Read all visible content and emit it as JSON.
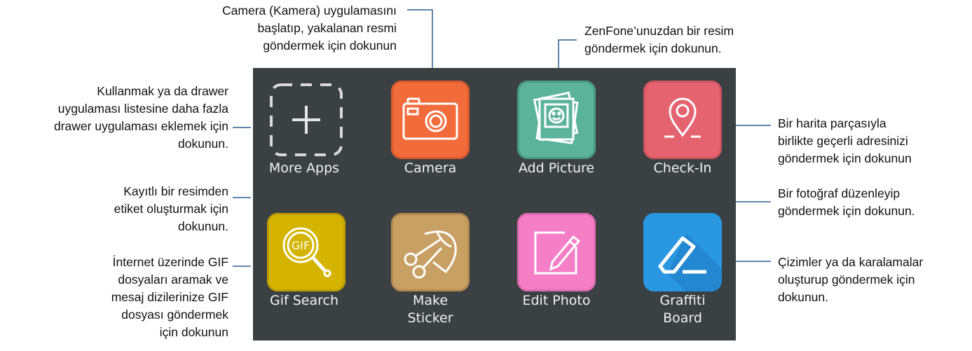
{
  "apps": [
    {
      "id": "more-apps",
      "label_lines": [
        "More Apps"
      ],
      "icon": "plus-icon"
    },
    {
      "id": "camera",
      "label_lines": [
        "Camera"
      ],
      "icon": "camera-icon",
      "color": "#f26b3a"
    },
    {
      "id": "add-picture",
      "label_lines": [
        "Add Picture"
      ],
      "icon": "photo-stack-icon",
      "color": "#5bb39a"
    },
    {
      "id": "check-in",
      "label_lines": [
        "Check-In"
      ],
      "icon": "map-pin-icon",
      "color": "#e4636f"
    },
    {
      "id": "gif-search",
      "label_lines": [
        "Gif Search"
      ],
      "icon": "gif-magnifier-icon",
      "color": "#d4b400"
    },
    {
      "id": "make-sticker",
      "label_lines": [
        "Make",
        "Sticker"
      ],
      "icon": "scissors-icon",
      "color": "#c9a063"
    },
    {
      "id": "edit-photo",
      "label_lines": [
        "Edit Photo"
      ],
      "icon": "pencil-edit-icon",
      "color": "#f57fc6"
    },
    {
      "id": "graffiti-board",
      "label_lines": [
        "Graffiti",
        "Board"
      ],
      "icon": "eraser-icon",
      "color": "#2a97e3"
    }
  ],
  "callouts": {
    "camera": [
      "Camera (Kamera) uygulamasını",
      "başlatıp, yakalanan resmi",
      "göndermek için dokunun"
    ],
    "add_picture": [
      "ZenFone’unuzdan bir resim",
      "göndermek için dokunun."
    ],
    "more_apps": [
      "Kullanmak ya da drawer",
      "uygulaması listesine daha fazla",
      "drawer uygulaması eklemek için",
      "dokunun."
    ],
    "check_in": [
      "Bir harita parçasıyla",
      "birlikte geçerli adresinizi",
      "göndermek için dokunun"
    ],
    "make_sticker": [
      "Kayıtlı bir resimden",
      "etiket oluşturmak için",
      "dokunun."
    ],
    "edit_photo": [
      "Bir fotoğraf düzenleyip",
      "göndermek için dokunun."
    ],
    "gif_search": [
      "İnternet üzerinde GIF",
      "dosyaları aramak ve",
      "mesaj dizilerinize GIF",
      "dosyası göndermek",
      "için dokunun"
    ],
    "graffiti_board": [
      "Çizimler ya da karalamalar",
      "oluşturup göndermek için",
      "dokunun."
    ]
  }
}
